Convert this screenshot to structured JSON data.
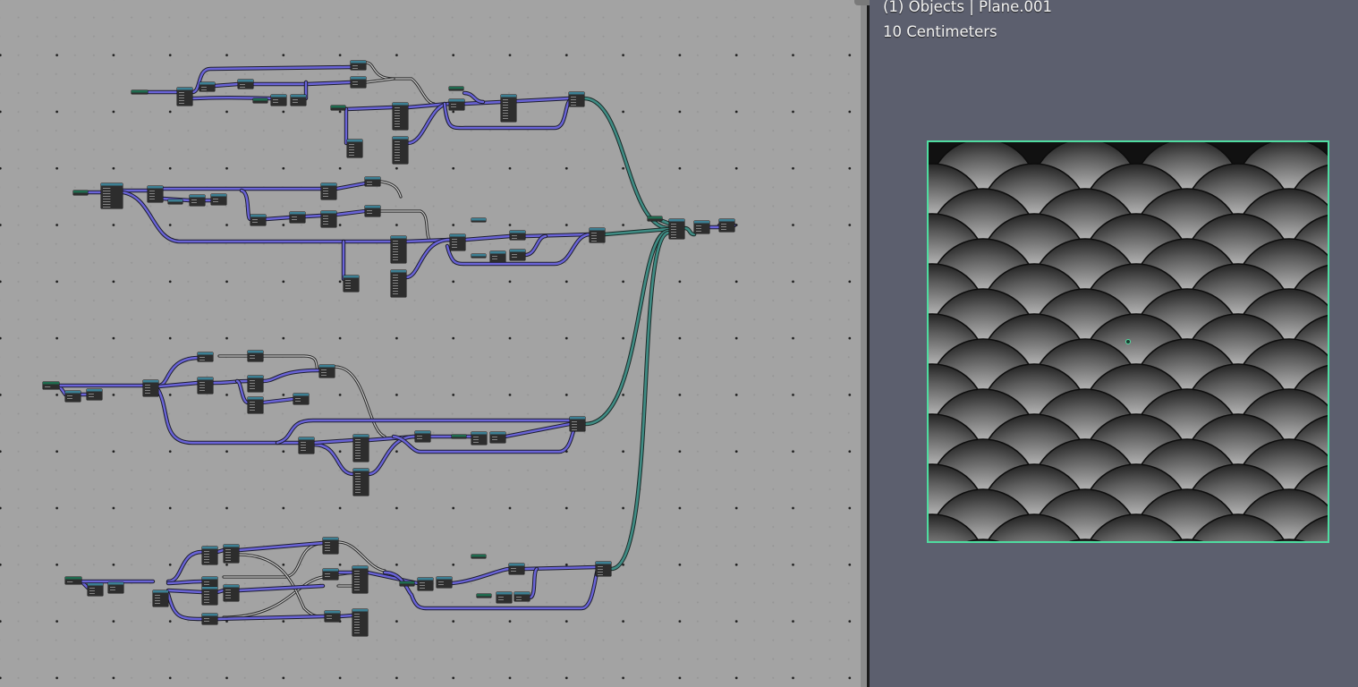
{
  "viewport": {
    "title": "(1) Objects | Plane.001",
    "units": "10 Centimeters"
  },
  "colors": {
    "editor_bg": "#a3a3a3",
    "viewport_bg": "#5c5f6e",
    "wire_geometry": "#6a64d8",
    "wire_shader": "#3f8c84",
    "selection_outline": "#4fdca0",
    "node_body": "#2d2d2d"
  }
}
